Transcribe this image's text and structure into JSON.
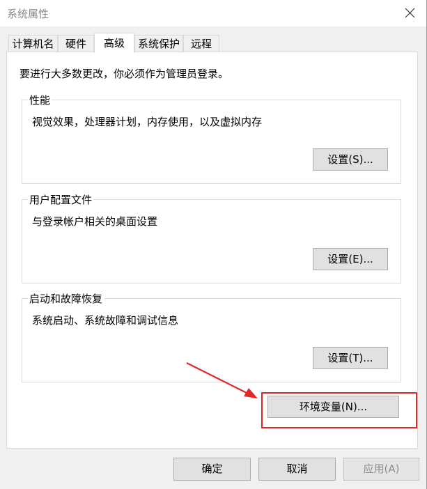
{
  "window": {
    "title": "系统属性"
  },
  "tabs": [
    {
      "label": "计算机名"
    },
    {
      "label": "硬件"
    },
    {
      "label": "高级"
    },
    {
      "label": "系统保护"
    },
    {
      "label": "远程"
    }
  ],
  "note": "要进行大多数更改，你必须作为管理员登录。",
  "performance": {
    "title": "性能",
    "desc": "视觉效果，处理器计划，内存使用，以及虚拟内存",
    "button": "设置(S)..."
  },
  "profiles": {
    "title": "用户配置文件",
    "desc": "与登录帐户相关的桌面设置",
    "button": "设置(E)..."
  },
  "startup": {
    "title": "启动和故障恢复",
    "desc": "系统启动、系统故障和调试信息",
    "button": "设置(T)..."
  },
  "env_button": "环境变量(N)...",
  "footer": {
    "ok": "确定",
    "cancel": "取消",
    "apply": "应用(A)"
  },
  "colors": {
    "annotation": "#e02828"
  },
  "icons": {
    "close": "close-icon",
    "arrow": "arrow-annotation"
  }
}
